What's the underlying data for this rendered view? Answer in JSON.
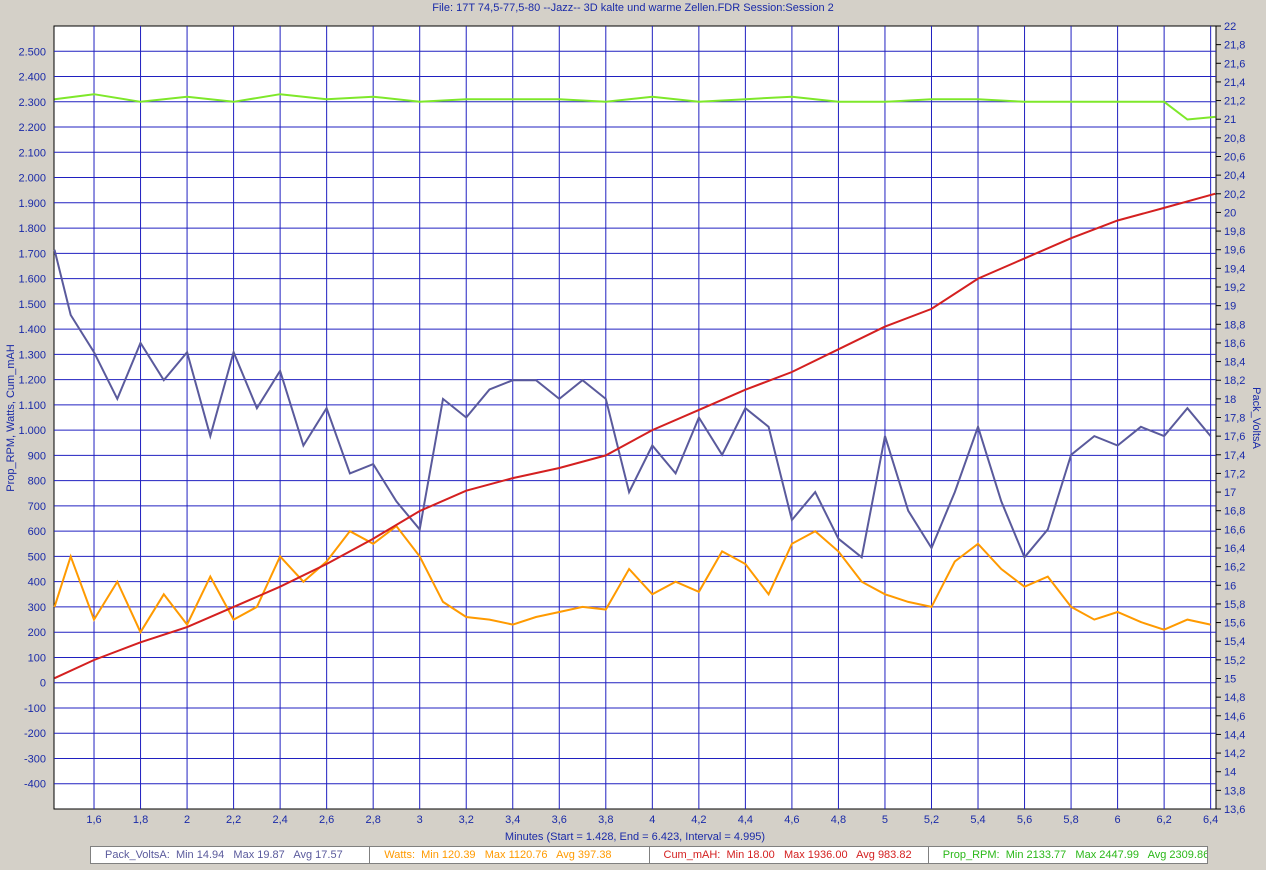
{
  "title": "File: 17T 74,5-77,5-80 --Jazz-- 3D kalte und warme Zellen.FDR   Session:Session 2",
  "chart_data": {
    "type": "line",
    "xlabel": "Minutes (Start = 1.428, End = 6.423, Interval = 4.995)",
    "ylabel_left": "Prop_RPM, Watts, Cum_mAH",
    "ylabel_right": "Pack_VoltsA",
    "xlim": [
      1.428,
      6.423
    ],
    "ylim_left": [
      -500,
      2600
    ],
    "ylim_right": [
      13.6,
      22
    ],
    "grid": true,
    "x_ticks": [
      "1,6",
      "1,8",
      "2",
      "2,2",
      "2,4",
      "2,6",
      "2,8",
      "3",
      "3,2",
      "3,4",
      "3,6",
      "3,8",
      "4",
      "4,2",
      "4,4",
      "4,6",
      "4,8",
      "5",
      "5,2",
      "5,4",
      "5,6",
      "5,8",
      "6",
      "6,2",
      "6,4"
    ],
    "y_left_ticks": [
      "2.500",
      "2.400",
      "2.300",
      "2.200",
      "2.100",
      "2.000",
      "1.900",
      "1.800",
      "1.700",
      "1.600",
      "1.500",
      "1.400",
      "1.300",
      "1.200",
      "1.100",
      "1.000",
      "900",
      "800",
      "700",
      "600",
      "500",
      "400",
      "300",
      "200",
      "100",
      "0",
      "-100",
      "-200",
      "-300",
      "-400"
    ],
    "y_right_ticks": [
      "22",
      "21,8",
      "21,6",
      "21,4",
      "21,2",
      "21",
      "20,8",
      "20,6",
      "20,4",
      "20,2",
      "20",
      "19,8",
      "19,6",
      "19,4",
      "19,2",
      "19",
      "18,8",
      "18,6",
      "18,4",
      "18,2",
      "18",
      "17,8",
      "17,6",
      "17,4",
      "17,2",
      "17",
      "16,8",
      "16,6",
      "16,4",
      "16,2",
      "16",
      "15,8",
      "15,6",
      "15,4",
      "15,2",
      "15",
      "14,8",
      "14,6",
      "14,4",
      "14,2",
      "14",
      "13,8",
      "13,6"
    ],
    "series": [
      {
        "name": "Pack_VoltsA",
        "axis": "right",
        "color": "#5a5a9c",
        "x": [
          1.43,
          1.5,
          1.6,
          1.7,
          1.8,
          1.9,
          2.0,
          2.1,
          2.2,
          2.3,
          2.4,
          2.5,
          2.6,
          2.7,
          2.8,
          2.9,
          3.0,
          3.1,
          3.2,
          3.3,
          3.4,
          3.5,
          3.6,
          3.7,
          3.8,
          3.9,
          4.0,
          4.1,
          4.2,
          4.3,
          4.4,
          4.5,
          4.6,
          4.7,
          4.8,
          4.9,
          5.0,
          5.1,
          5.2,
          5.3,
          5.4,
          5.5,
          5.6,
          5.7,
          5.8,
          5.9,
          6.0,
          6.1,
          6.2,
          6.3,
          6.4
        ],
        "y": [
          19.6,
          18.9,
          18.5,
          18.0,
          18.6,
          18.2,
          18.5,
          17.6,
          18.5,
          17.9,
          18.3,
          17.5,
          17.9,
          17.2,
          17.3,
          16.9,
          16.6,
          18.0,
          17.8,
          18.1,
          18.2,
          18.2,
          18.0,
          18.2,
          18.0,
          17.0,
          17.5,
          17.2,
          17.8,
          17.4,
          17.9,
          17.7,
          16.7,
          17.0,
          16.5,
          16.3,
          17.6,
          16.8,
          16.4,
          17.0,
          17.7,
          16.9,
          16.3,
          16.6,
          17.4,
          17.6,
          17.5,
          17.7,
          17.6,
          17.9,
          17.6
        ]
      },
      {
        "name": "Watts",
        "axis": "left",
        "color": "#ff9a00",
        "x": [
          1.43,
          1.5,
          1.6,
          1.7,
          1.8,
          1.9,
          2.0,
          2.1,
          2.2,
          2.3,
          2.4,
          2.5,
          2.6,
          2.7,
          2.8,
          2.9,
          3.0,
          3.1,
          3.2,
          3.3,
          3.4,
          3.5,
          3.6,
          3.7,
          3.8,
          3.9,
          4.0,
          4.1,
          4.2,
          4.3,
          4.4,
          4.5,
          4.6,
          4.7,
          4.8,
          4.9,
          5.0,
          5.1,
          5.2,
          5.3,
          5.4,
          5.5,
          5.6,
          5.7,
          5.8,
          5.9,
          6.0,
          6.1,
          6.2,
          6.3,
          6.4
        ],
        "y": [
          300,
          500,
          250,
          400,
          200,
          350,
          230,
          420,
          250,
          300,
          500,
          400,
          480,
          600,
          550,
          620,
          500,
          320,
          260,
          250,
          230,
          260,
          280,
          300,
          290,
          450,
          350,
          400,
          360,
          520,
          470,
          350,
          550,
          600,
          520,
          400,
          350,
          320,
          300,
          480,
          550,
          450,
          380,
          420,
          300,
          250,
          280,
          240,
          210,
          250,
          230
        ]
      },
      {
        "name": "Cum_mAH",
        "axis": "left",
        "color": "#d42020",
        "x": [
          1.43,
          1.6,
          1.8,
          2.0,
          2.2,
          2.4,
          2.6,
          2.8,
          3.0,
          3.2,
          3.4,
          3.6,
          3.8,
          4.0,
          4.2,
          4.4,
          4.6,
          4.8,
          5.0,
          5.2,
          5.4,
          5.6,
          5.8,
          6.0,
          6.2,
          6.42
        ],
        "y": [
          18,
          90,
          160,
          220,
          300,
          380,
          470,
          570,
          680,
          760,
          810,
          850,
          900,
          1000,
          1080,
          1160,
          1230,
          1320,
          1410,
          1480,
          1600,
          1680,
          1760,
          1830,
          1880,
          1936
        ]
      },
      {
        "name": "Prop_RPM",
        "axis": "left",
        "color": "#7ee82a",
        "x": [
          1.43,
          1.6,
          1.8,
          2.0,
          2.2,
          2.4,
          2.6,
          2.8,
          3.0,
          3.2,
          3.4,
          3.6,
          3.8,
          4.0,
          4.2,
          4.4,
          4.6,
          4.8,
          5.0,
          5.2,
          5.4,
          5.6,
          5.8,
          6.0,
          6.2,
          6.3,
          6.42
        ],
        "y": [
          2310,
          2330,
          2300,
          2320,
          2300,
          2330,
          2310,
          2320,
          2300,
          2310,
          2310,
          2310,
          2300,
          2320,
          2300,
          2310,
          2320,
          2300,
          2300,
          2310,
          2310,
          2300,
          2300,
          2300,
          2300,
          2230,
          2240
        ]
      }
    ],
    "legend": [
      {
        "name": "Pack_VoltsA",
        "min": "14.94",
        "max": "19.87",
        "avg": "17.57",
        "color": "#5a5a9c"
      },
      {
        "name": "Watts",
        "min": "120.39",
        "max": "1120.76",
        "avg": "397.38",
        "color": "#ff9a00"
      },
      {
        "name": "Cum_mAH",
        "min": "18.00",
        "max": "1936.00",
        "avg": "983.82",
        "color": "#d42020"
      },
      {
        "name": "Prop_RPM",
        "min": "2133.77",
        "max": "2447.99",
        "avg": "2309.86",
        "color": "#2ab818"
      }
    ]
  }
}
